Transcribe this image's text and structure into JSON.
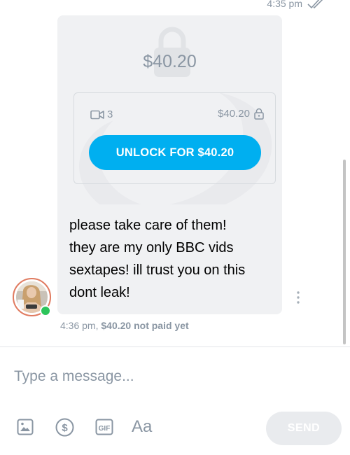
{
  "top": {
    "time": "4:35 pm",
    "read_icon": "double-check-icon"
  },
  "post": {
    "big_price": "$40.20",
    "big_icon": "lock-icon",
    "media_icon": "video-icon",
    "media_count": "3",
    "price": "$40.20",
    "price_icon": "lock-icon",
    "unlock_label": "UNLOCK FOR $40.20",
    "message_lines": [
      "please take care of them!",
      "they are my only BBC vids",
      "sextapes! ill trust you on this",
      "dont leak!"
    ],
    "time": "4:36 pm,",
    "payment_status": "$40.20 not paid yet",
    "more_icon": "more-vertical-icon",
    "avatar_status": "online"
  },
  "composer": {
    "placeholder": "Type a message...",
    "tools": [
      "image-icon",
      "dollar-icon",
      "gif-icon",
      "text-format-icon"
    ],
    "text_format_label": "Aa",
    "send_label": "SEND"
  },
  "colors": {
    "accent": "#00aff0",
    "muted": "#8a96a3",
    "bubble_bg": "#f0f1f3",
    "online": "#2cc45a",
    "send_disabled": "#e9ebee"
  }
}
